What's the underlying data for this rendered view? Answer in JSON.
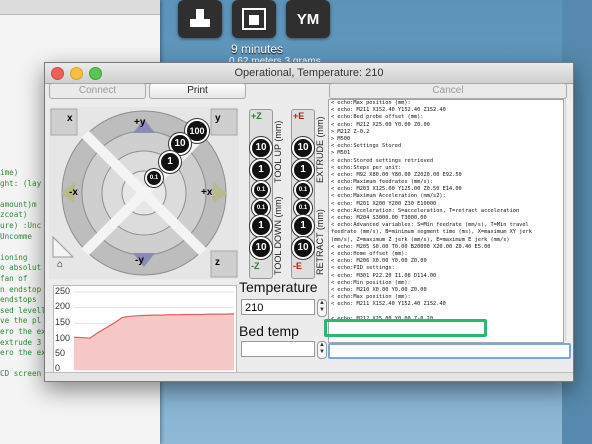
{
  "background": {
    "dock_tiles": [
      "",
      "",
      "YM"
    ],
    "time_label": "9 minutes",
    "sub_label": "0.62 meters 3 grams",
    "code_lines": [
      "ime)",
      "ght: (lay",
      "",
      "amount)m",
      "zcoat)",
      "ure) :Unc",
      "Uncomme",
      "",
      "ioning",
      "o absolut",
      "fan of",
      "n endstop",
      "endstops",
      "sed levell",
      "ve the pl",
      "ero the ex",
      "extrude 3",
      "ero the ext",
      "",
      "CD screen"
    ]
  },
  "window": {
    "title": "Operational, Temperature: 210",
    "buttons": {
      "connect": "Connect",
      "print": "Print",
      "cancel": "Cancel"
    }
  },
  "jog": {
    "labels": {
      "yplus": "+y",
      "yminus": "-y",
      "xplus": "+x",
      "xminus": "-x",
      "zplus": "+Z",
      "zminus": "-Z",
      "eplus": "+E",
      "eminus": "-E",
      "homex": "x",
      "homey": "y",
      "homez": "z"
    },
    "ring_steps": [
      "100",
      "10",
      "1",
      "0.1"
    ],
    "tool_up": "TOOL UP (mm)",
    "tool_down": "TOOL DOWN (mm)",
    "extrude": "EXTRUDE (mm)",
    "retract": "RETRACT (mm)",
    "z_steps_up": [
      "10",
      "1",
      "0.1"
    ],
    "z_steps_down": [
      "0.1",
      "1",
      "10"
    ]
  },
  "graph": {
    "y_ticks": [
      "250",
      "200",
      "150",
      "100",
      "50",
      "0"
    ],
    "colors": {
      "fill": "#f7c8c8",
      "line": "#e06060"
    },
    "temperature_series": [
      105,
      104,
      102,
      120,
      135,
      150,
      168,
      172,
      174,
      175,
      176,
      176,
      177,
      177,
      178,
      178,
      178,
      179,
      179,
      179,
      180
    ]
  },
  "controls": {
    "temperature_label": "Temperature",
    "temperature_value": "210",
    "bed_label": "Bed temp",
    "bed_value": ""
  },
  "console": {
    "lines": [
      "< echo:Max position (mm):",
      "< echo:  M211 X152.40 Y152.40 Z152.40",
      "< echo:Bed probe offset (mm):",
      "< echo:  M212 X25.00 Y0.00 Z0.00",
      "> M212 Z-0.2",
      "> M500",
      "< echo:Settings Stored",
      "> M501",
      "< echo:Stored settings retrieved",
      "< echo:Steps per unit:",
      "< echo:  M92 X80.00 Y80.00 Z2020.00 E92.50",
      "< echo:Maximum feedrates (mm/s):",
      "< echo:  M203 X125.00 Y125.00 Z0.50 E14.00",
      "< echo:Maximum Acceleration (mm/s2):",
      "< echo:  M201 X200 Y200 Z30 E10000",
      "< echo:Acceleration: S=acceleration, T=retract acceleration",
      "< echo:  M204 S3000.00 T3000.00",
      "< echo:Advanced variables: S=Min feedrate (mm/s), T=Min travel",
      "feedrate (mm/s), B=minimum segment time (ms), X=maximum XY jerk",
      "(mm/s),  Z=maximum Z jerk (mm/s),  E=maximum E jerk (mm/s)",
      "< echo:  M205 S0.00 T0.00 B20000 X20.00 Z0.40 E5.00",
      "< echo:Home offset (mm):",
      "< echo:  M206 X0.00 Y0.00 Z0.00",
      "< echo:PID settings:",
      "< echo:   M301 P22.20 I1.08 D114.00",
      "< echo:Min position (mm):",
      "< echo:  M210 X0.00 Y0.00 Z0.00",
      "< echo:Max position (mm):",
      "< echo:  M211 X152.40 Y152.40 Z152.40",
      "",
      "< echo:  M212 X25.00 Y0.00 Z-0.20"
    ],
    "highlight_color": "#2bb673",
    "command_value": ""
  }
}
